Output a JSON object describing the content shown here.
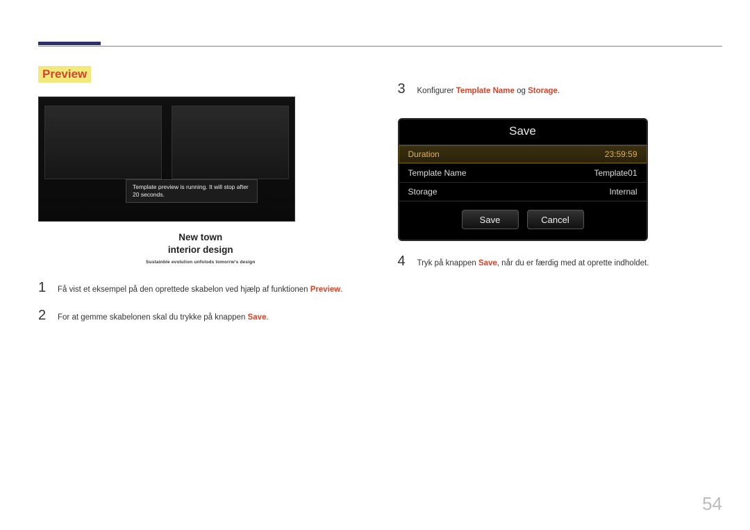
{
  "section_title": "Preview",
  "preview_popup": "Template preview is running. It will stop after 20 seconds.",
  "caption": {
    "line1": "New town",
    "line2": "interior design",
    "sub": "Sustainble evolution unfolods tomorrw's design"
  },
  "left_steps": [
    {
      "num": "1",
      "parts": [
        {
          "t": "Få vist et eksempel på den oprettede skabelon ved hjælp af funktionen "
        },
        {
          "t": "Preview",
          "cls": "hl-orange"
        },
        {
          "t": "."
        }
      ]
    },
    {
      "num": "2",
      "parts": [
        {
          "t": "For at gemme skabelonen skal du trykke på knappen "
        },
        {
          "t": "Save",
          "cls": "hl-orange"
        },
        {
          "t": "."
        }
      ]
    }
  ],
  "right_steps": [
    {
      "num": "3",
      "parts": [
        {
          "t": "Konfigurer "
        },
        {
          "t": "Template Name",
          "cls": "hl-orange"
        },
        {
          "t": " og "
        },
        {
          "t": "Storage",
          "cls": "hl-orange"
        },
        {
          "t": "."
        }
      ]
    },
    {
      "num": "4",
      "parts": [
        {
          "t": "Tryk på knappen "
        },
        {
          "t": "Save",
          "cls": "hl-orange"
        },
        {
          "t": ", når du er færdig med at oprette indholdet."
        }
      ]
    }
  ],
  "dialog": {
    "title": "Save",
    "rows": [
      {
        "label": "Duration",
        "value": "23:59:59",
        "selected": true
      },
      {
        "label": "Template Name",
        "value": "Template01",
        "selected": false
      },
      {
        "label": "Storage",
        "value": "Internal",
        "selected": false
      }
    ],
    "buttons": {
      "save": "Save",
      "cancel": "Cancel"
    }
  },
  "page_number": "54"
}
